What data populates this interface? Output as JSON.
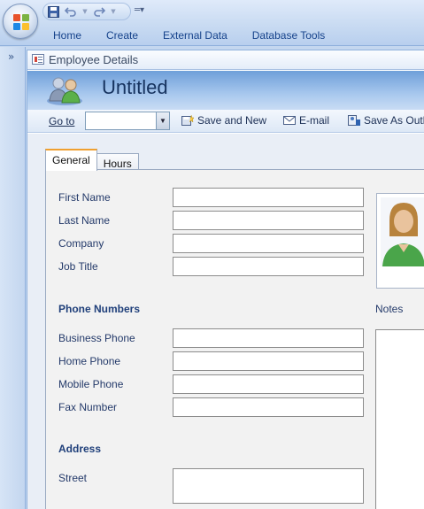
{
  "ribbon": {
    "tabs": [
      "Home",
      "Create",
      "External Data",
      "Database Tools"
    ],
    "qat_icons": [
      "save-icon",
      "undo-icon",
      "redo-icon"
    ]
  },
  "nav_pane": {
    "toggle_glyph": "»"
  },
  "document": {
    "tab_title": "Employee Details",
    "header_title": "Untitled"
  },
  "toolbar": {
    "goto_label": "Go to",
    "goto_value": "",
    "save_new": "Save and New",
    "email": "E-mail",
    "save_outlook": "Save As Outlo"
  },
  "form": {
    "tabs": [
      "General",
      "Hours"
    ],
    "active_tab": "General",
    "fields": {
      "first_name": {
        "label": "First Name",
        "value": ""
      },
      "last_name": {
        "label": "Last Name",
        "value": ""
      },
      "company": {
        "label": "Company",
        "value": ""
      },
      "job_title": {
        "label": "Job Title",
        "value": ""
      },
      "business_phone": {
        "label": "Business Phone",
        "value": ""
      },
      "home_phone": {
        "label": "Home Phone",
        "value": ""
      },
      "mobile_phone": {
        "label": "Mobile Phone",
        "value": ""
      },
      "fax_number": {
        "label": "Fax Number",
        "value": ""
      },
      "street": {
        "label": "Street",
        "value": ""
      }
    },
    "sections": {
      "phone": "Phone Numbers",
      "address": "Address"
    },
    "notes_label": "Notes"
  },
  "colors": {
    "header_blue": "#6f9fd9",
    "tab_accent": "#f0a030",
    "section_text": "#1f3f7a"
  }
}
